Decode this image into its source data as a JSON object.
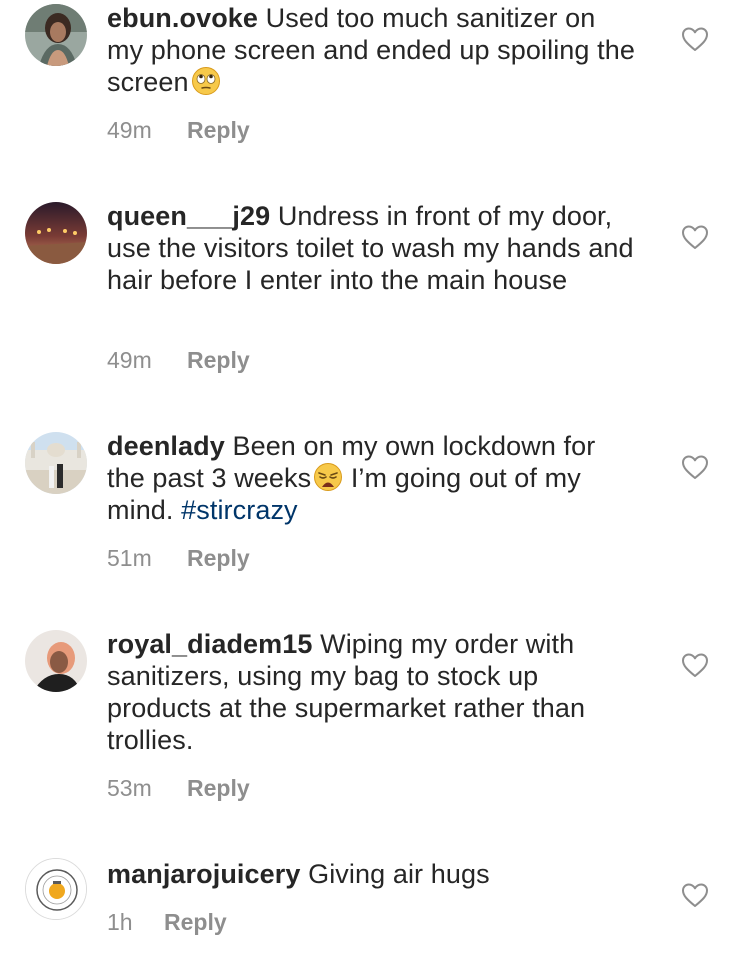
{
  "comments": [
    {
      "username": "ebun.ovoke",
      "text": "Used too much sanitizer on my phone screen and ended up spoiling the screen",
      "emoji": "face-with-rolling-eyes",
      "time": "49m",
      "reply": "Reply"
    },
    {
      "username": "queen___j29",
      "text": "Undress in front of my door, use the visitors toilet to wash my hands and hair before I enter into the main house",
      "time": "49m",
      "reply": "Reply"
    },
    {
      "username": "deenlady",
      "text_before": "Been on my own lockdown for the past 3 weeks",
      "emoji": "weary-face",
      "text_after": " I’m going out of my mind.",
      "hashtag": "#stircrazy",
      "time": "51m",
      "reply": "Reply"
    },
    {
      "username": "royal_diadem15",
      "text": "Wiping my order with sanitizers, using my bag to stock up products at the supermarket rather than trollies.",
      "time": "53m",
      "reply": "Reply"
    },
    {
      "username": "manjarojuicery",
      "text": "Giving air hugs",
      "time": "1h",
      "reply": "Reply"
    }
  ],
  "colors": {
    "text": "#262626",
    "meta": "#8e8e8e",
    "hashtag": "#003569"
  }
}
